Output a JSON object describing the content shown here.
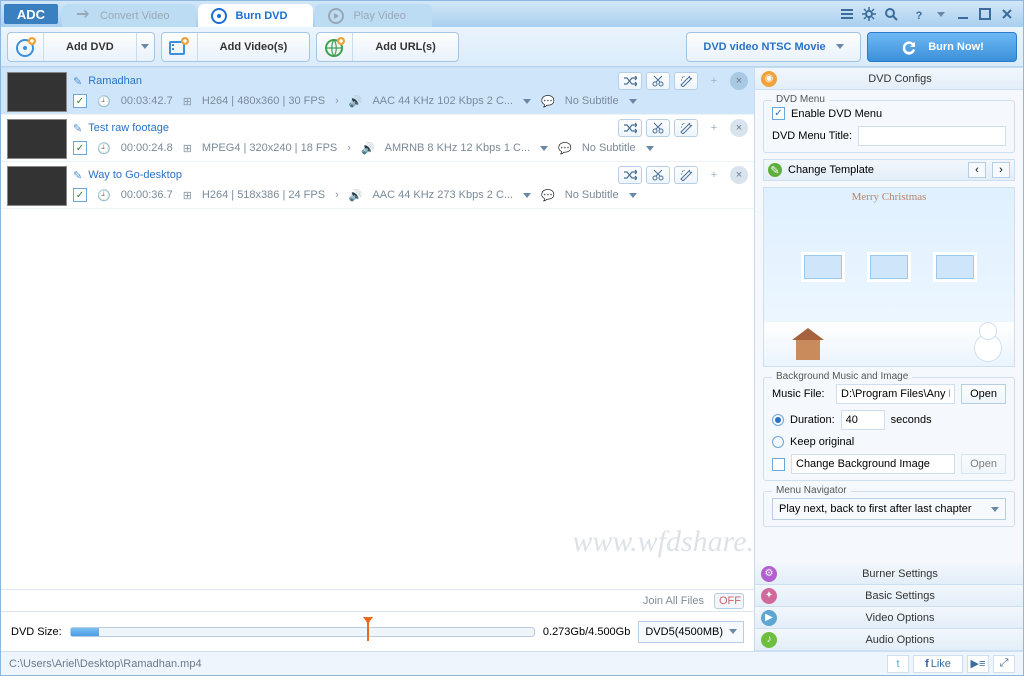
{
  "app": {
    "logo": "ADC"
  },
  "tabs": [
    {
      "label": "Convert Video"
    },
    {
      "label": "Burn DVD"
    },
    {
      "label": "Play Video"
    }
  ],
  "toolbar": {
    "add_dvd": "Add DVD",
    "add_videos": "Add Video(s)",
    "add_urls": "Add URL(s)",
    "profile": "DVD video NTSC Movie",
    "burn": "Burn Now!"
  },
  "rows": [
    {
      "title": "Ramadhan",
      "duration": "00:03:42.7",
      "video": "H264 | 480x360 | 30 FPS",
      "audio": "AAC 44 KHz 102 Kbps 2 C...",
      "subtitle": "No Subtitle",
      "selected": true
    },
    {
      "title": "Test raw footage",
      "duration": "00:00:24.8",
      "video": "MPEG4 | 320x240 | 18 FPS",
      "audio": "AMRNB 8 KHz 12 Kbps 1 C...",
      "subtitle": "No Subtitle",
      "selected": false
    },
    {
      "title": "Way to Go-desktop",
      "duration": "00:00:36.7",
      "video": "H264 | 518x386 | 24 FPS",
      "audio": "AAC 44 KHz 273 Kbps 2 C...",
      "subtitle": "No Subtitle",
      "selected": false
    }
  ],
  "join": {
    "label": "Join All Files",
    "state": "OFF"
  },
  "size": {
    "label": "DVD Size:",
    "text": "0.273Gb/4.500Gb",
    "media": "DVD5(4500MB)",
    "fill_pct": 6,
    "over_pct": 64
  },
  "configs": {
    "header": "DVD Configs",
    "dvd_menu_legend": "DVD Menu",
    "enable_menu": "Enable DVD Menu",
    "menu_title_label": "DVD Menu Title:",
    "change_template": "Change Template",
    "merry": "Merry  Christmas",
    "bg_legend": "Background Music and Image",
    "music_label": "Music File:",
    "music_value": "D:\\Program Files\\Any I",
    "open": "Open",
    "duration_label": "Duration:",
    "duration_value": "40",
    "seconds": "seconds",
    "keep_original": "Keep original",
    "change_bg": "Change Background Image",
    "nav_legend": "Menu Navigator",
    "nav_value": "Play next, back to first after last chapter"
  },
  "panels": {
    "burner": "Burner Settings",
    "basic": "Basic Settings",
    "video": "Video Options",
    "audio": "Audio Options"
  },
  "status": {
    "path": "C:\\Users\\Ariel\\Desktop\\Ramadhan.mp4",
    "like": "Like"
  },
  "watermark": "www.wfdshare.com"
}
